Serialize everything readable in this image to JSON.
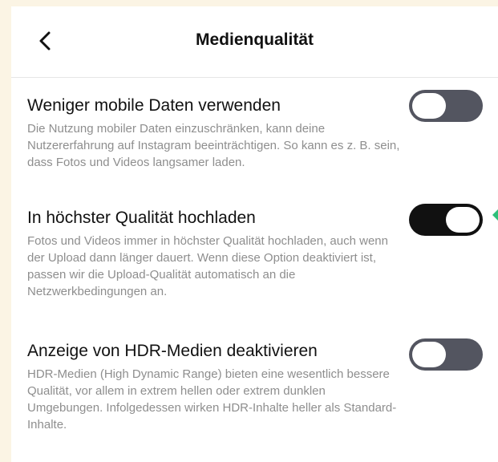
{
  "header": {
    "title": "Medienqualität",
    "back_icon": "chevron-left-icon"
  },
  "settings": [
    {
      "label": "Weniger mobile Daten verwenden",
      "description": "Die Nutzung mobiler Daten einzuschränken, kann deine Nutzererfahrung auf Instagram beeinträchtigen. So kann es z. B. sein, dass Fotos und Videos langsamer laden.",
      "enabled": false
    },
    {
      "label": "In höchster Qualität hochladen",
      "description": "Fotos und Videos immer in höchster Qualität hochladen, auch wenn der Upload dann länger dauert. Wenn diese Option deaktiviert ist, passen wir die Upload-Qualität automatisch an die Netzwerkbedingungen an.",
      "enabled": true
    },
    {
      "label": "Anzeige von HDR-Medien deaktivieren",
      "description": "HDR-Medien (High Dynamic Range) bieten eine wesentlich bessere Qualität, vor allem in extrem hellen oder extrem dunklen Umgebungen. Infolgedessen wirken HDR-Inhalte heller als Standard-Inhalte.",
      "enabled": false
    }
  ],
  "colors": {
    "toggle_on": "#111111",
    "toggle_off": "#535560",
    "pointer_accent": "#2fc07a",
    "page_background": "#fbf4e4"
  }
}
